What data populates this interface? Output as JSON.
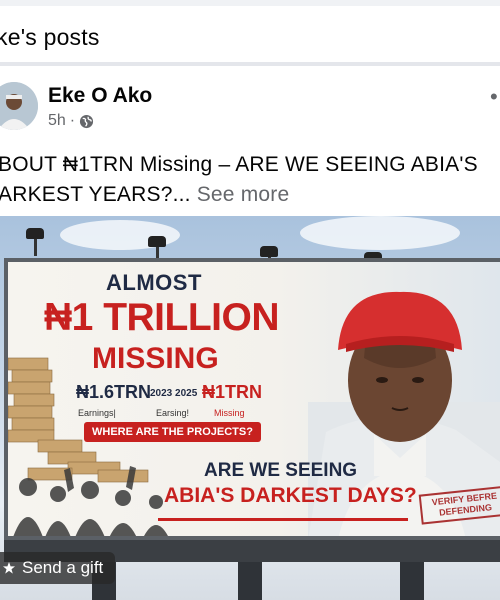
{
  "header": {
    "title": "ke's posts"
  },
  "post": {
    "author": "Eke O Ako",
    "time": "5h",
    "separator": "·",
    "text_line1": "BOUT ₦1TRN Missing – ARE WE SEEING ABIA'S",
    "text_line2": "ARKEST YEARS?...",
    "see_more": "See more",
    "more_icon": "more-dots-icon"
  },
  "billboard": {
    "almost": "ALMOST",
    "trillion": "₦1 TRILLION",
    "missing": "MISSING",
    "amount_earned": "₦1.6TRN",
    "years": "2023 2025",
    "amount_missing": "₦1TRN",
    "earnings_label_1": "Earnings|",
    "earnings_label_2": "Earsing!",
    "missing_label": "Missing",
    "projects_question": "WHERE ARE THE PROJECTS?",
    "seeing": "ARE WE SEEING",
    "darkest": "ABIA'S DARKEST DAYS?",
    "stamp": "VERIFY BEFRE DEFENDING"
  },
  "actions": {
    "send_gift": "Send a gift"
  },
  "colors": {
    "accent_red": "#c7211f",
    "navy": "#1f2a44",
    "meta_gray": "#65676b"
  }
}
